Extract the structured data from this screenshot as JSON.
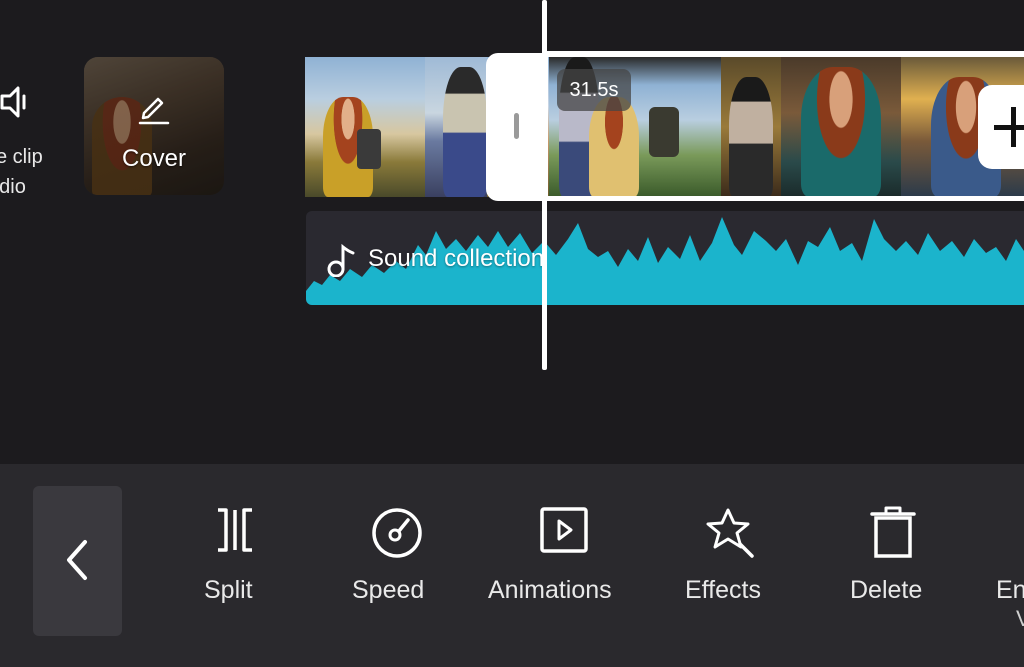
{
  "timeline": {
    "mute_control": {
      "line1": "e clip",
      "line2": "udio",
      "icon": "speaker-icon"
    },
    "cover": {
      "label": "Cover",
      "icon": "pencil-icon"
    },
    "selected_clip": {
      "duration": "31.5s"
    },
    "add_clip_icon": "plus-icon",
    "audio": {
      "label": "Sound collection",
      "icon": "music-note-icon",
      "wave_color": "#1bb4cc"
    }
  },
  "toolbar": {
    "back_icon": "chevron-left-icon",
    "tools": [
      {
        "id": "split",
        "label": "Split",
        "icon": "split-icon"
      },
      {
        "id": "speed",
        "label": "Speed",
        "icon": "speed-icon"
      },
      {
        "id": "animations",
        "label": "Animations",
        "icon": "play-square-icon"
      },
      {
        "id": "effects",
        "label": "Effects",
        "icon": "star-wand-icon"
      },
      {
        "id": "delete",
        "label": "Delete",
        "icon": "trash-icon"
      },
      {
        "id": "extra",
        "label": "En",
        "sublabel": "V"
      }
    ]
  },
  "colors": {
    "background": "#1c1b1e",
    "toolbar": "#2a292d",
    "accent": "#1bb4cc"
  }
}
